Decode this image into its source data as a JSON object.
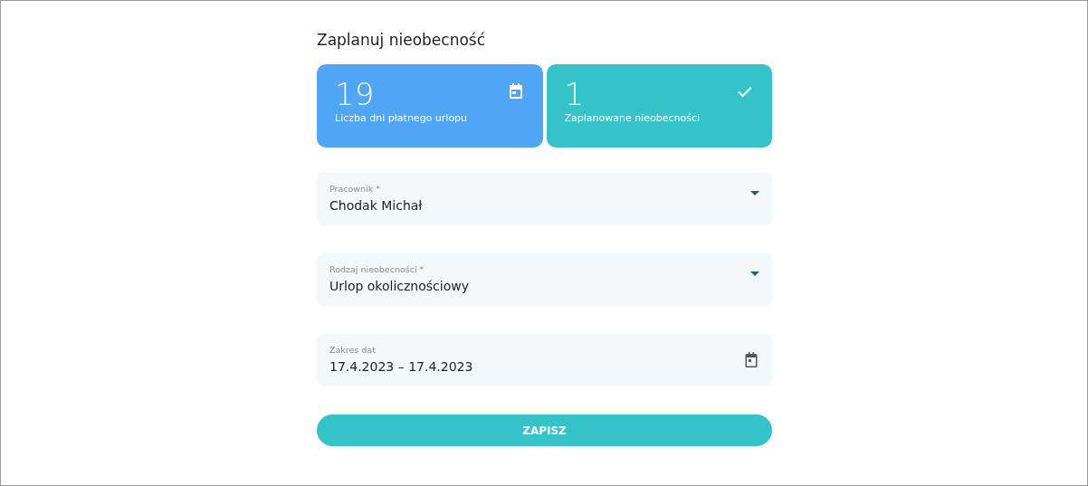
{
  "title": "Zaplanuj nieobecność",
  "cards": [
    {
      "value": "19",
      "label": "Liczba dni płatnego urlopu",
      "kind": "allowance",
      "color": "#4fa6f7"
    },
    {
      "value": "1",
      "label": "Zaplanowane nieobecności",
      "kind": "planned",
      "color": "#33c3c8"
    }
  ],
  "fields": [
    {
      "kind": "select",
      "label": "Pracownik *",
      "value": "Chodak Michał"
    },
    {
      "kind": "select",
      "label": "Rodzaj nieobecności *",
      "value": "Urlop okolicznościowy"
    },
    {
      "kind": "date",
      "label": "Zakres dat",
      "value": "17.4.2023 – 17.4.2023"
    }
  ],
  "button": "ZAPISZ"
}
